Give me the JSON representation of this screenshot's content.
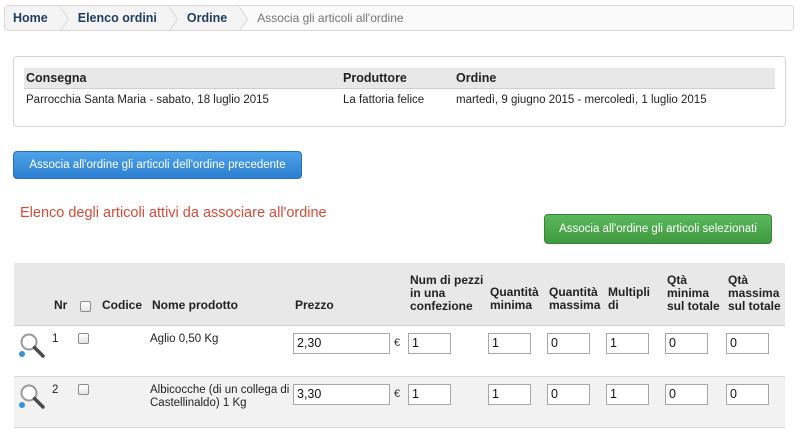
{
  "breadcrumb": {
    "items": [
      "Home",
      "Elenco ordini",
      "Ordine"
    ],
    "current": "Associa gli articoli all'ordine"
  },
  "info": {
    "headers": [
      "Consegna",
      "Produttore",
      "Ordine"
    ],
    "row": [
      "Parrocchia Santa Maria - sabato, 18 luglio 2015",
      "La fattoria felice",
      "martedì, 9 giugno 2015 - mercoledì, 1 luglio 2015"
    ]
  },
  "buttons": {
    "copy_previous": "Associa all'ordine gli articoli dell'ordine precedente",
    "associate_selected": "Associa all'ordine gli articoli selezionati"
  },
  "section_title": "Elenco degli articoli attivi da associare all'ordine",
  "table": {
    "headers": {
      "nr": "Nr",
      "codice": "Codice",
      "nome": "Nome prodotto",
      "prezzo": "Prezzo",
      "pezzi": "Num di pezzi in una confezione",
      "qmin": "Quantità minima",
      "qmax": "Quantità massima",
      "multipli": "Multipli di",
      "qtmin": "Qtà minima sul totale",
      "qtmax": "Qtà massima sul totale"
    },
    "currency": "€",
    "rows": [
      {
        "nr": "1",
        "codice": "",
        "nome": "Aglio 0,50 Kg",
        "prezzo": "2,30",
        "pezzi": "1",
        "qmin": "1",
        "qmax": "0",
        "multipli": "1",
        "qtmin": "0",
        "qtmax": "0"
      },
      {
        "nr": "2",
        "codice": "",
        "nome": "Albicocche (di un collega di Castellinaldo) 1 Kg",
        "prezzo": "3,30",
        "pezzi": "1",
        "qmin": "1",
        "qmax": "0",
        "multipli": "1",
        "qtmin": "0",
        "qtmax": "0"
      }
    ]
  },
  "colors": {
    "blue_button": "#3a8fdd",
    "green_button": "#4cae4c",
    "title_red": "#d64b3a",
    "breadcrumb_text": "#1f3d5f"
  },
  "icons": [
    "magnifier-icon"
  ]
}
